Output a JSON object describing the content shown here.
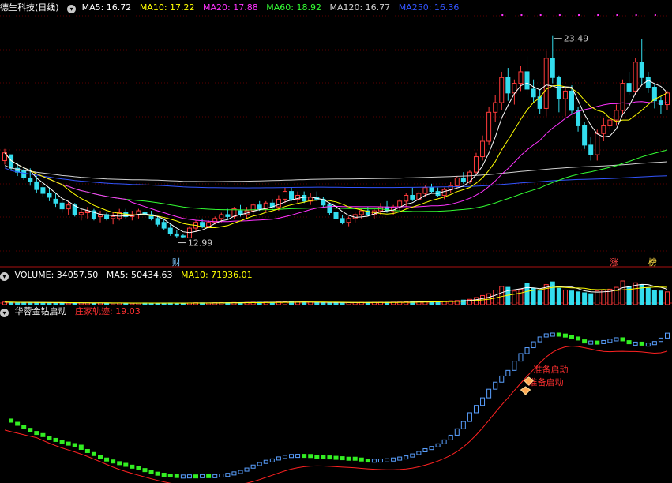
{
  "header": {
    "stock_name": "德生科技(日线)",
    "ma_labels": [
      {
        "text": "MA5: 16.72",
        "color": "#ffffff"
      },
      {
        "text": "MA10: 17.22",
        "color": "#ffff00"
      },
      {
        "text": "MA20: 17.88",
        "color": "#ff33ff"
      },
      {
        "text": "MA60: 18.92",
        "color": "#33ff33"
      },
      {
        "text": "MA120: 16.77",
        "color": "#d0d0d0"
      },
      {
        "text": "MA250: 16.36",
        "color": "#3355ff"
      }
    ]
  },
  "volume_header": {
    "title": "VOLUME: 34057.50",
    "ma5": "MA5: 50434.63",
    "ma10": "MA10: 71936.01"
  },
  "indicator_header": {
    "title": "华蓉金钻启动",
    "line_label": "庄家轨迹: 19.03"
  },
  "colors": {
    "up": "#ff3b3b",
    "down": "#33ddee",
    "ma5": "#ffffff",
    "ma10": "#ffff00",
    "ma20": "#ff33ff",
    "ma60": "#33ff33",
    "ma120": "#d0d0d0",
    "ma250": "#3355ff",
    "indicator_up": "#5aa0ff",
    "indicator_down": "#33ee22",
    "trail_line": "#ff2222"
  },
  "chart_data": {
    "type": "candlestick",
    "price_ylim": [
      11.5,
      24.5
    ],
    "annotations": {
      "high_label": "23.49",
      "high_value": 23.49,
      "low_label": "12.99",
      "low_value": 12.99,
      "badge_cai": "财",
      "badge_zhang": "涨",
      "badge_bang": "榜",
      "signal_1": "准备启动",
      "signal_2": "准备启动"
    },
    "ohlc": [
      [
        17.0,
        17.6,
        16.8,
        17.4
      ],
      [
        17.3,
        17.3,
        16.5,
        16.6
      ],
      [
        16.6,
        16.9,
        16.2,
        16.4
      ],
      [
        16.5,
        16.7,
        16.0,
        16.1
      ],
      [
        16.1,
        16.6,
        15.7,
        15.9
      ],
      [
        15.9,
        16.2,
        15.3,
        15.5
      ],
      [
        15.6,
        15.8,
        15.1,
        15.3
      ],
      [
        15.3,
        15.6,
        14.9,
        15.1
      ],
      [
        15.0,
        15.3,
        14.6,
        14.8
      ],
      [
        14.8,
        15.0,
        14.3,
        14.5
      ],
      [
        14.5,
        14.9,
        14.2,
        14.7
      ],
      [
        14.7,
        14.8,
        14.1,
        14.2
      ],
      [
        14.2,
        14.5,
        13.9,
        14.3
      ],
      [
        14.3,
        14.6,
        14.0,
        14.4
      ],
      [
        14.4,
        14.5,
        13.9,
        14.0
      ],
      [
        14.1,
        14.4,
        13.8,
        14.2
      ],
      [
        14.2,
        14.3,
        13.9,
        14.0
      ],
      [
        14.0,
        14.3,
        13.7,
        14.1
      ],
      [
        14.0,
        14.5,
        13.9,
        14.3
      ],
      [
        14.3,
        14.5,
        14.0,
        14.1
      ],
      [
        14.1,
        14.4,
        13.9,
        14.2
      ],
      [
        14.2,
        14.5,
        14.0,
        14.4
      ],
      [
        14.3,
        14.6,
        14.1,
        14.2
      ],
      [
        14.2,
        14.4,
        13.9,
        14.0
      ],
      [
        14.0,
        14.1,
        13.6,
        13.7
      ],
      [
        13.8,
        14.0,
        13.4,
        13.5
      ],
      [
        13.5,
        13.7,
        13.1,
        13.2
      ],
      [
        13.2,
        13.4,
        12.99,
        13.1
      ],
      [
        13.1,
        13.2,
        12.99,
        13.05
      ],
      [
        13.0,
        13.6,
        12.99,
        13.5
      ],
      [
        13.5,
        13.9,
        13.3,
        13.8
      ],
      [
        13.8,
        14.0,
        13.5,
        13.6
      ],
      [
        13.6,
        13.9,
        13.5,
        13.8
      ],
      [
        13.8,
        14.1,
        13.7,
        14.0
      ],
      [
        14.0,
        14.3,
        13.8,
        14.2
      ],
      [
        14.2,
        14.5,
        14.0,
        14.1
      ],
      [
        14.1,
        14.6,
        14.0,
        14.5
      ],
      [
        14.4,
        14.7,
        14.1,
        14.2
      ],
      [
        14.2,
        14.6,
        14.0,
        14.4
      ],
      [
        14.4,
        14.8,
        14.2,
        14.7
      ],
      [
        14.7,
        14.9,
        14.4,
        14.5
      ],
      [
        14.5,
        14.9,
        14.3,
        14.8
      ],
      [
        14.8,
        15.0,
        14.5,
        14.6
      ],
      [
        14.6,
        15.2,
        14.4,
        15.0
      ],
      [
        15.0,
        15.6,
        14.8,
        15.4
      ],
      [
        15.4,
        15.6,
        14.9,
        15.0
      ],
      [
        15.0,
        15.4,
        14.8,
        15.2
      ],
      [
        15.2,
        15.4,
        14.8,
        14.9
      ],
      [
        14.9,
        15.3,
        14.7,
        15.1
      ],
      [
        15.1,
        15.4,
        14.9,
        15.0
      ],
      [
        15.0,
        15.1,
        14.6,
        14.7
      ],
      [
        14.7,
        14.8,
        14.2,
        14.3
      ],
      [
        14.3,
        14.5,
        13.9,
        14.0
      ],
      [
        14.0,
        14.2,
        13.7,
        13.8
      ],
      [
        13.8,
        14.1,
        13.6,
        14.0
      ],
      [
        14.0,
        14.3,
        13.8,
        14.2
      ],
      [
        14.2,
        14.5,
        14.0,
        14.4
      ],
      [
        14.4,
        14.6,
        14.1,
        14.2
      ],
      [
        14.2,
        14.5,
        14.0,
        14.4
      ],
      [
        14.4,
        14.8,
        14.2,
        14.6
      ],
      [
        14.6,
        14.9,
        14.3,
        14.4
      ],
      [
        14.4,
        14.7,
        14.2,
        14.6
      ],
      [
        14.6,
        15.0,
        14.4,
        14.9
      ],
      [
        14.9,
        15.3,
        14.6,
        15.2
      ],
      [
        15.2,
        15.6,
        14.9,
        15.0
      ],
      [
        15.0,
        15.4,
        14.9,
        15.3
      ],
      [
        15.3,
        15.7,
        15.1,
        15.6
      ],
      [
        15.6,
        15.8,
        15.3,
        15.4
      ],
      [
        15.4,
        15.6,
        15.1,
        15.2
      ],
      [
        15.2,
        15.6,
        15.0,
        15.5
      ],
      [
        15.5,
        15.9,
        15.3,
        15.7
      ],
      [
        15.7,
        16.2,
        15.6,
        16.1
      ],
      [
        16.1,
        16.4,
        15.8,
        15.9
      ],
      [
        15.9,
        16.5,
        15.8,
        16.4
      ],
      [
        16.4,
        17.4,
        16.3,
        17.2
      ],
      [
        17.2,
        18.3,
        17.0,
        18.0
      ],
      [
        18.0,
        19.8,
        17.8,
        19.5
      ],
      [
        19.5,
        20.4,
        19.0,
        20.0
      ],
      [
        20.0,
        21.6,
        19.6,
        21.3
      ],
      [
        21.3,
        21.8,
        20.1,
        20.5
      ],
      [
        20.5,
        21.2,
        19.9,
        21.0
      ],
      [
        21.0,
        21.9,
        20.6,
        21.6
      ],
      [
        21.6,
        22.4,
        20.4,
        20.7
      ],
      [
        20.7,
        21.2,
        20.0,
        20.3
      ],
      [
        20.3,
        20.7,
        19.4,
        19.7
      ],
      [
        19.7,
        22.7,
        19.3,
        22.3
      ],
      [
        22.3,
        23.49,
        21.0,
        21.3
      ],
      [
        21.3,
        21.4,
        19.5,
        20.2
      ],
      [
        20.2,
        20.8,
        19.3,
        20.6
      ],
      [
        20.6,
        20.9,
        19.4,
        19.6
      ],
      [
        19.6,
        19.8,
        18.5,
        18.8
      ],
      [
        18.8,
        19.0,
        17.6,
        17.8
      ],
      [
        17.8,
        18.2,
        17.0,
        17.3
      ],
      [
        17.3,
        18.6,
        17.0,
        18.4
      ],
      [
        18.4,
        19.2,
        18.0,
        18.8
      ],
      [
        18.8,
        19.4,
        18.6,
        19.1
      ],
      [
        19.1,
        19.9,
        18.8,
        19.6
      ],
      [
        19.6,
        21.2,
        19.4,
        21.0
      ],
      [
        21.0,
        21.6,
        20.4,
        20.6
      ],
      [
        20.6,
        22.3,
        20.4,
        22.1
      ],
      [
        22.1,
        23.3,
        20.9,
        21.3
      ],
      [
        21.3,
        21.6,
        20.5,
        20.8
      ],
      [
        20.8,
        21.0,
        19.7,
        20.1
      ],
      [
        20.1,
        20.3,
        19.4,
        19.9
      ],
      [
        19.9,
        20.6,
        19.6,
        20.5
      ]
    ],
    "volume": [
      28,
      25,
      26,
      23,
      22,
      24,
      22,
      21,
      20,
      19,
      18,
      20,
      18,
      19,
      17,
      18,
      17,
      16,
      18,
      17,
      16,
      17,
      18,
      17,
      16,
      17,
      18,
      17,
      16,
      18,
      20,
      19,
      18,
      20,
      22,
      21,
      23,
      22,
      24,
      26,
      25,
      27,
      26,
      29,
      32,
      30,
      28,
      27,
      26,
      25,
      24,
      23,
      22,
      21,
      22,
      23,
      24,
      23,
      24,
      26,
      25,
      27,
      28,
      30,
      32,
      33,
      36,
      35,
      34,
      38,
      42,
      45,
      50,
      58,
      78,
      100,
      120,
      160,
      200,
      190,
      150,
      170,
      230,
      180,
      150,
      220,
      250,
      180,
      160,
      150,
      140,
      130,
      120,
      150,
      160,
      170,
      190,
      260,
      200,
      240,
      220,
      180,
      160,
      150,
      140
    ],
    "indicator_trail_ylim": [
      0,
      100
    ]
  }
}
